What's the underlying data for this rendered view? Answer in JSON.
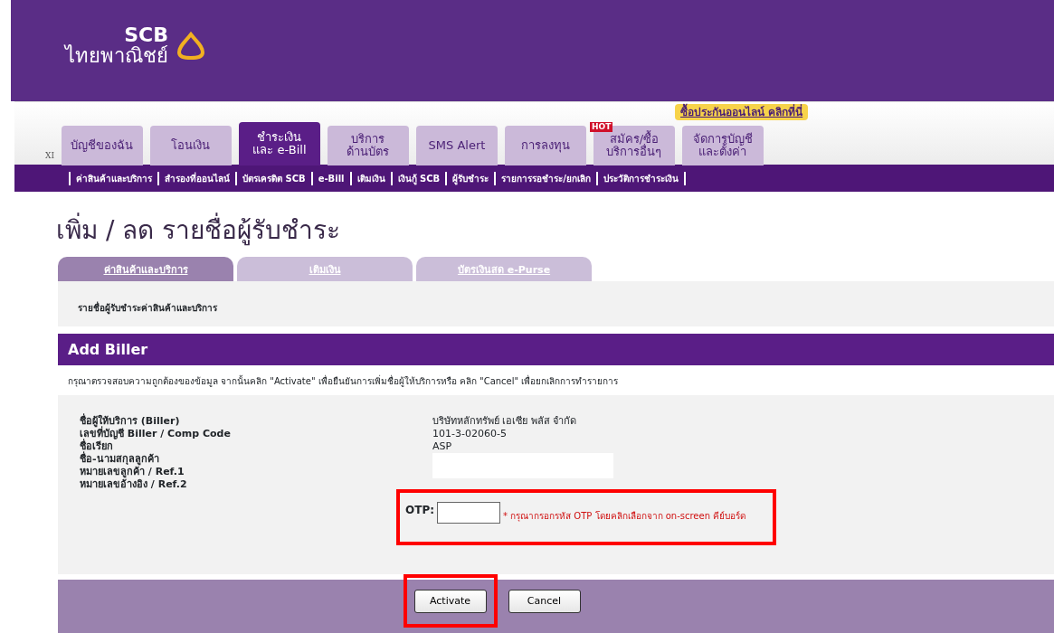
{
  "header": {
    "logo_text": "SCB",
    "logo_subtext": "ไทยพาณิชย์"
  },
  "promo": "ซื้อประกันออนไลน์ คลิกที่นี่",
  "nav_marker": "XI",
  "main_tabs": [
    {
      "lines": [
        "บัญชีของฉัน"
      ],
      "selected": false
    },
    {
      "lines": [
        "โอนเงิน"
      ],
      "selected": false
    },
    {
      "lines": [
        "ชำระเงิน",
        "และ e-Bill"
      ],
      "selected": true
    },
    {
      "lines": [
        "บริการ",
        "ด้านบัตร"
      ],
      "selected": false
    },
    {
      "lines": [
        "SMS Alert"
      ],
      "selected": false
    },
    {
      "lines": [
        "การลงทุน"
      ],
      "selected": false
    },
    {
      "lines": [
        "สมัคร/ซื้อ",
        "บริการอื่นๆ"
      ],
      "selected": false,
      "hot_label": "HOT"
    },
    {
      "lines": [
        "จัดการบัญชี",
        "และตั้งค่า"
      ],
      "selected": false
    }
  ],
  "sub_menu": [
    "ค่าสินค้าและบริการ",
    "สำรองที่ออนไลน์",
    "บัตรเครดิต SCB",
    "e-Bill",
    "เติมเงิน",
    "เงินกู้ SCB",
    "ผู้รับชำระ",
    "รายการรอชำระ/ยกเลิก",
    "ประวัติการชำระเงิน"
  ],
  "page_title": "เพิ่ม / ลด รายชื่อผู้รับชำระ",
  "page_tabs": [
    {
      "label": "ค่าสินค้าและบริการ",
      "selected": true
    },
    {
      "label": "เติมเงิน",
      "selected": false
    },
    {
      "label": "บัตรเงินสด e-Purse",
      "selected": false
    }
  ],
  "section_label": "รายชื่อผู้รับชำระค่าสินค้าและบริการ",
  "panel_title": "Add Biller",
  "instruction": "กรุณาตรวจสอบความถูกต้องของข้อมูล จากนั้นคลิก \"Activate\" เพื่อยืนยันการเพิ่มชื่อผู้ให้บริการหรือ คลิก \"Cancel\" เพื่อยกเลิกการทำรายการ",
  "fields": [
    {
      "label": "ชื่อผู้ให้บริการ (Biller)",
      "kind": "text",
      "value": "บริษัทหลักทรัพย์ เอเซีย พลัส จำกัด"
    },
    {
      "label": "เลขที่บัญชี Biller / Comp Code",
      "kind": "text",
      "value": "101-3-02060-5"
    },
    {
      "label": "ชื่อเรียก",
      "kind": "text",
      "value": "ASP"
    },
    {
      "label": "ชื่อ-นามสกุลลูกค้า",
      "kind": "blank"
    },
    {
      "label": "หมายเลขลูกค้า / Ref.1",
      "kind": "blank"
    },
    {
      "label": "หมายเลขอ้างอิง / Ref.2",
      "kind": "none"
    }
  ],
  "otp": {
    "label": "OTP:",
    "note": "* กรุณากรอกรหัส OTP โดยคลิกเลือกจาก on-screen คีย์บอร์ด",
    "highlighted": true
  },
  "buttons": [
    {
      "label": "Activate",
      "highlighted": true
    },
    {
      "label": "Cancel",
      "highlighted": false
    }
  ]
}
